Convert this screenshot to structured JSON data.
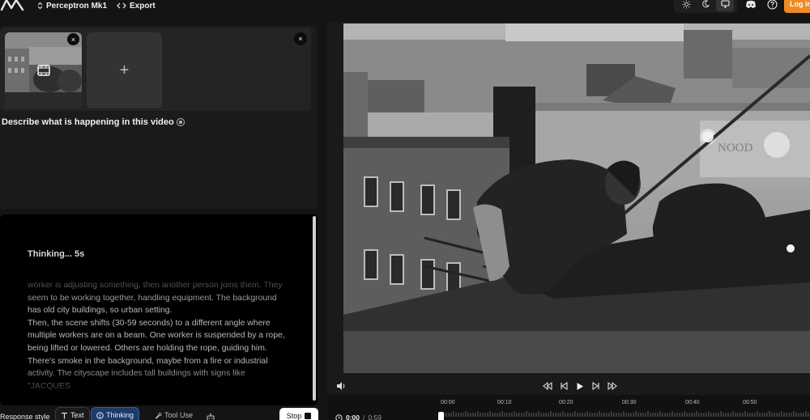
{
  "header": {
    "model_name": "Perceptron Mk1",
    "export_label": "Export",
    "login_label": "Log in",
    "accent_color": "#f08a24",
    "icons": [
      "sun-icon",
      "moon-icon",
      "monitor-icon",
      "discord-icon",
      "help-icon"
    ]
  },
  "input": {
    "prompt": "Describe what is happening in this video",
    "add_label": "+",
    "close_glyph": "×"
  },
  "response": {
    "thinking_label": "Thinking... 5s",
    "paragraphs": [
      "worker is adjusting something, then another person joins them. They seem to be working together, handling equipment. The background has old city buildings, so urban setting.",
      "Then, the scene shifts (30-59 seconds) to a different angle where multiple workers are on a beam. One worker is suspended by a rope, being lifted or lowered. Others are holding the rope, guiding him. There's smoke in the background, maybe from a fire or industrial activity. The cityscape includes tall buildings with signs like \"JACQUES"
    ]
  },
  "toolbar": {
    "response_style_label": "Response style",
    "text_label": "Text",
    "thinking_label": "Thinking",
    "tool_use_label": "Tool Use",
    "stop_label": "Stop",
    "thinking_color": "#1e3a66"
  },
  "player": {
    "current_time": "0:00",
    "separator": "/",
    "duration": "0:59",
    "ticks": [
      "00:00",
      "00:10",
      "00:20",
      "00:30",
      "00:40",
      "00:50"
    ],
    "progress": 0
  }
}
